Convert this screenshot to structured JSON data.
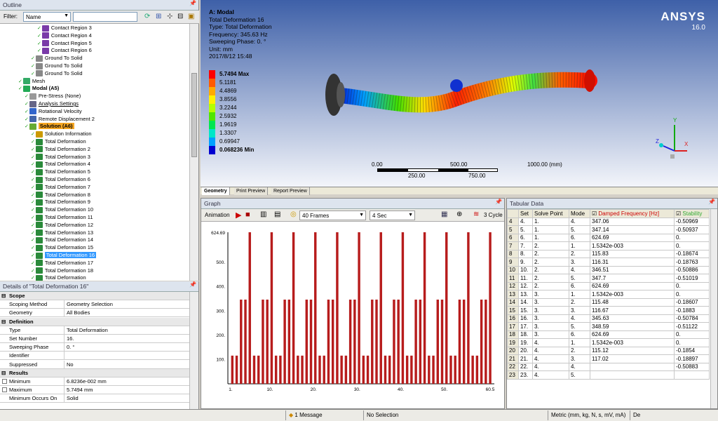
{
  "outline": {
    "title": "Outline",
    "filter_label": "Filter:",
    "filter_value": "Name",
    "items": [
      {
        "label": "Contact Region 3",
        "indent": 5,
        "icon": "contact-icon"
      },
      {
        "label": "Contact Region 4",
        "indent": 5,
        "icon": "contact-icon"
      },
      {
        "label": "Contact Region 5",
        "indent": 5,
        "icon": "contact-icon"
      },
      {
        "label": "Contact Region 6",
        "indent": 5,
        "icon": "contact-icon"
      },
      {
        "label": "Ground To Solid",
        "indent": 4,
        "icon": "joint-icon"
      },
      {
        "label": "Ground To Solid",
        "indent": 4,
        "icon": "joint-icon"
      },
      {
        "label": "Ground To Solid",
        "indent": 4,
        "icon": "joint-icon"
      },
      {
        "label": "Mesh",
        "indent": 2,
        "icon": "mesh-icon"
      },
      {
        "label": "Modal (A5)",
        "indent": 2,
        "icon": "modal-icon",
        "bold": true
      },
      {
        "label": "Pre-Stress (None)",
        "indent": 3,
        "icon": "prestress-icon"
      },
      {
        "label": "Analysis Settings",
        "indent": 3,
        "icon": "settings-icon",
        "underline": true
      },
      {
        "label": "Rotational Velocity",
        "indent": 3,
        "icon": "velocity-icon"
      },
      {
        "label": "Remote Displacement 2",
        "indent": 3,
        "icon": "displacement-icon"
      },
      {
        "label": "Solution (A6)",
        "indent": 3,
        "icon": "solution-icon",
        "highlight": true
      },
      {
        "label": "Solution Information",
        "indent": 4,
        "icon": "info-icon"
      },
      {
        "label": "Total Deformation",
        "indent": 4,
        "icon": "deformation-icon"
      },
      {
        "label": "Total Deformation 2",
        "indent": 4,
        "icon": "deformation-icon"
      },
      {
        "label": "Total Deformation 3",
        "indent": 4,
        "icon": "deformation-icon"
      },
      {
        "label": "Total Deformation 4",
        "indent": 4,
        "icon": "deformation-icon"
      },
      {
        "label": "Total Deformation 5",
        "indent": 4,
        "icon": "deformation-icon"
      },
      {
        "label": "Total Deformation 6",
        "indent": 4,
        "icon": "deformation-icon"
      },
      {
        "label": "Total Deformation 7",
        "indent": 4,
        "icon": "deformation-icon"
      },
      {
        "label": "Total Deformation 8",
        "indent": 4,
        "icon": "deformation-icon"
      },
      {
        "label": "Total Deformation 9",
        "indent": 4,
        "icon": "deformation-icon"
      },
      {
        "label": "Total Deformation 10",
        "indent": 4,
        "icon": "deformation-icon"
      },
      {
        "label": "Total Deformation 11",
        "indent": 4,
        "icon": "deformation-icon"
      },
      {
        "label": "Total Deformation 12",
        "indent": 4,
        "icon": "deformation-icon"
      },
      {
        "label": "Total Deformation 13",
        "indent": 4,
        "icon": "deformation-icon"
      },
      {
        "label": "Total Deformation 14",
        "indent": 4,
        "icon": "deformation-icon"
      },
      {
        "label": "Total Deformation 15",
        "indent": 4,
        "icon": "deformation-icon"
      },
      {
        "label": "Total Deformation 16",
        "indent": 4,
        "icon": "deformation-icon",
        "selected": true
      },
      {
        "label": "Total Deformation 17",
        "indent": 4,
        "icon": "deformation-icon"
      },
      {
        "label": "Total Deformation 18",
        "indent": 4,
        "icon": "deformation-icon"
      },
      {
        "label": "Total Deformation",
        "indent": 4,
        "icon": "deformation-icon"
      }
    ]
  },
  "details": {
    "title": "Details of \"Total Deformation 16\"",
    "rows": [
      {
        "section": true,
        "key": "Scope"
      },
      {
        "key": "Scoping Method",
        "value": "Geometry Selection"
      },
      {
        "key": "Geometry",
        "value": "All Bodies"
      },
      {
        "section": true,
        "key": "Definition"
      },
      {
        "key": "Type",
        "value": "Total Deformation"
      },
      {
        "key": "Set Number",
        "value": "16."
      },
      {
        "key": "Sweeping Phase",
        "value": "0. °"
      },
      {
        "key": "Identifier",
        "value": ""
      },
      {
        "key": "Suppressed",
        "value": "No"
      },
      {
        "section": true,
        "key": "Results"
      },
      {
        "key": "Minimum",
        "value": "6.8236e-002 mm"
      },
      {
        "key": "Maximum",
        "value": "5.7494 mm"
      },
      {
        "key": "Minimum Occurs On",
        "value": "Solid"
      }
    ]
  },
  "viewport": {
    "line1": "A: Modal",
    "line2": "Total Deformation 16",
    "line3": "Type: Total Deformation",
    "line4": "Frequency: 345.63 Hz",
    "line5": "Sweeping Phase: 0. °",
    "line6": "Unit: mm",
    "line7": "2017/8/12 15:48",
    "brand": "ANSYS",
    "version": "16.0",
    "legend": [
      {
        "label": "5.7494 Max",
        "color": "#ff0000"
      },
      {
        "label": "5.1181",
        "color": "#ff5a00"
      },
      {
        "label": "4.4869",
        "color": "#ffaa00"
      },
      {
        "label": "3.8556",
        "color": "#fff000"
      },
      {
        "label": "3.2244",
        "color": "#b4ff00"
      },
      {
        "label": "2.5932",
        "color": "#50e600"
      },
      {
        "label": "1.9619",
        "color": "#00e650"
      },
      {
        "label": "1.3307",
        "color": "#00e6c8"
      },
      {
        "label": "0.69947",
        "color": "#00a0ff"
      },
      {
        "label": "0.068236 Min",
        "color": "#0000d0"
      }
    ],
    "scale_top": [
      "0.00",
      "500.00",
      "1000.00 (mm)"
    ],
    "scale_bottom": [
      "250.00",
      "750.00"
    ],
    "axis_y": "Y",
    "axis_z": "Z",
    "axis_x": "X",
    "tabs": [
      "Geometry",
      "Print Preview",
      "Report Preview"
    ]
  },
  "graph": {
    "title": "Graph",
    "animation_label": "Animation",
    "frames": "40 Frames",
    "duration": "4 Sec",
    "cycle": "3 Cycle"
  },
  "chart_data": {
    "type": "bar",
    "ylim": [
      0,
      624.69
    ],
    "yticks": [
      "100.",
      "200.",
      "300.",
      "400.",
      "500."
    ],
    "ytop": "624.69",
    "xticks": [
      "1.",
      "10.",
      "20.",
      "30.",
      "40.",
      "50.",
      "60.5"
    ],
    "values": [
      116.17,
      116.17,
      347.06,
      347.06,
      624.69,
      116.17,
      116.17,
      347.06,
      347.06,
      624.69,
      116.17,
      116.17,
      347.06,
      347.06,
      624.69,
      116.17,
      116.17,
      347.06,
      347.06,
      624.69,
      116.17,
      116.17,
      347.06,
      347.06,
      624.69,
      116.17,
      116.17,
      347.06,
      347.06,
      624.69,
      116.17,
      116.17,
      347.06,
      347.06,
      624.69,
      116.17,
      116.17,
      347.06,
      347.06,
      624.69,
      116.17,
      116.17,
      347.06,
      347.06,
      624.69,
      116.17,
      116.17,
      347.06,
      347.06,
      624.69,
      116.17,
      116.17,
      347.06,
      347.06,
      624.69,
      116.17,
      116.17,
      347.06,
      347.06,
      624.69
    ]
  },
  "tabular": {
    "title": "Tabular Data",
    "headers": [
      "",
      "Set",
      "Solve Point",
      "Mode",
      "Damped Frequency [Hz]",
      "Stability"
    ],
    "rows": [
      [
        "4",
        "4.",
        "1.",
        "4.",
        "347.06",
        "-0.50969"
      ],
      [
        "5",
        "5.",
        "1.",
        "5.",
        "347.14",
        "-0.50937"
      ],
      [
        "6",
        "6.",
        "1.",
        "6.",
        "624.69",
        "0."
      ],
      [
        "7",
        "7.",
        "2.",
        "1.",
        "1.5342e-003",
        "0."
      ],
      [
        "8",
        "8.",
        "2.",
        "2.",
        "115.83",
        "-0.18674"
      ],
      [
        "9",
        "9.",
        "2.",
        "3.",
        "116.31",
        "-0.18763"
      ],
      [
        "10",
        "10.",
        "2.",
        "4.",
        "346.51",
        "-0.50886"
      ],
      [
        "11",
        "11.",
        "2.",
        "5.",
        "347.7",
        "-0.51019"
      ],
      [
        "12",
        "12.",
        "2.",
        "6.",
        "624.69",
        "0."
      ],
      [
        "13",
        "13.",
        "3.",
        "1.",
        "1.5342e-003",
        "0."
      ],
      [
        "14",
        "14.",
        "3.",
        "2.",
        "115.48",
        "-0.18607"
      ],
      [
        "15",
        "15.",
        "3.",
        "3.",
        "116.67",
        "-0.1883"
      ],
      [
        "16",
        "16.",
        "3.",
        "4.",
        "345.63",
        "-0.50784"
      ],
      [
        "17",
        "17.",
        "3.",
        "5.",
        "348.59",
        "-0.51122"
      ],
      [
        "18",
        "18.",
        "3.",
        "6.",
        "624.69",
        "0."
      ],
      [
        "19",
        "19.",
        "4.",
        "1.",
        "1.5342e-003",
        "0."
      ],
      [
        "20",
        "20.",
        "4.",
        "2.",
        "115.12",
        "-0.1854"
      ],
      [
        "21",
        "21.",
        "4.",
        "3.",
        "117.02",
        "-0.18897"
      ],
      [
        "22",
        "22.",
        "4.",
        "4.",
        "",
        "-0.50883"
      ],
      [
        "23",
        "23.",
        "4.",
        "5.",
        "",
        ""
      ]
    ]
  },
  "status": {
    "message": "1 Message",
    "selection": "No Selection",
    "units": "Metric (mm, kg, N, s, mV, mA)",
    "extra": "De"
  },
  "colors": {
    "bar": "#b71c1c",
    "selection": "#3399ff",
    "solution_highlight": "#f5a623"
  }
}
